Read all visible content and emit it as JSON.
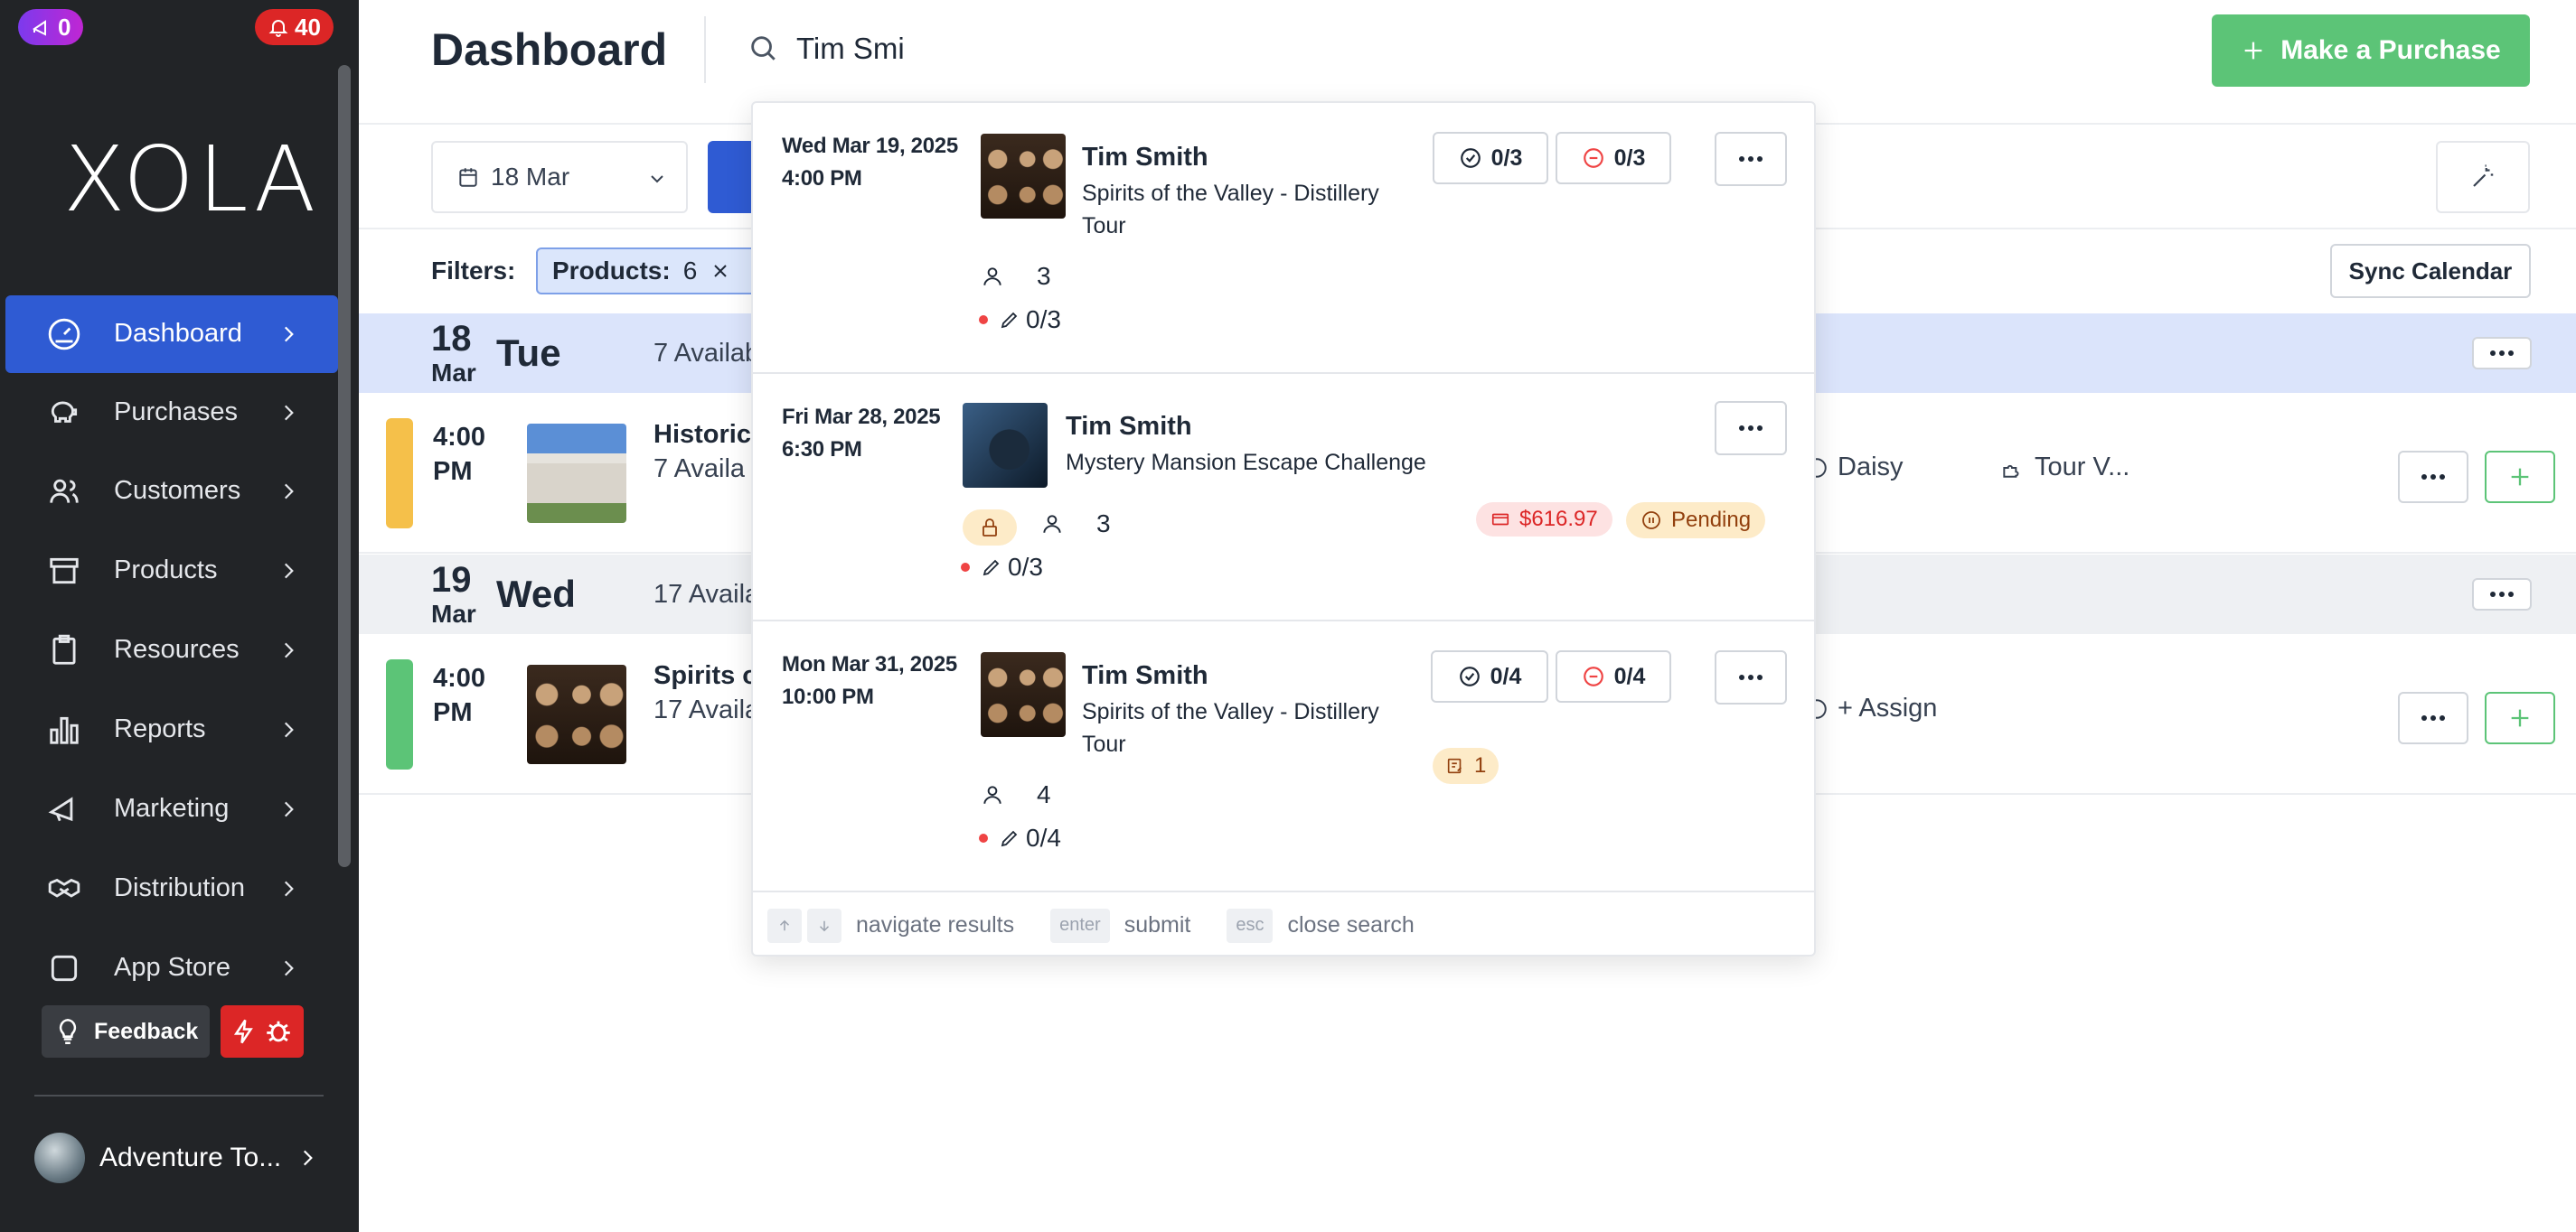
{
  "sidebar": {
    "badge_left": "0",
    "badge_right": "40",
    "logo": "XOLA",
    "items": [
      {
        "label": "Dashboard",
        "active": true
      },
      {
        "label": "Purchases"
      },
      {
        "label": "Customers"
      },
      {
        "label": "Products"
      },
      {
        "label": "Resources"
      },
      {
        "label": "Reports"
      },
      {
        "label": "Marketing"
      },
      {
        "label": "Distribution"
      },
      {
        "label": "App Store"
      }
    ],
    "feedback_label": "Feedback",
    "account_name": "Adventure To..."
  },
  "header": {
    "title": "Dashboard",
    "search_value": "Tim Smi",
    "purchase_label": "Make a Purchase"
  },
  "toolbar": {
    "date_value": "18 Mar",
    "filters_label": "Filters:",
    "filter_chip_label": "Products:",
    "filter_chip_count": "6",
    "sync_label": "Sync Calendar"
  },
  "days": [
    {
      "num": "18",
      "mon": "Mar",
      "name": "Tue",
      "avail": "7 Availab"
    },
    {
      "num": "19",
      "mon": "Mar",
      "name": "Wed",
      "avail": "17 Availa"
    }
  ],
  "slots": [
    {
      "time": "4:00",
      "ampm": "PM",
      "title": "Historic",
      "avail": "7 Availa",
      "guide": "Daisy",
      "vehicle": "Tour V...",
      "color": "#f5c04a"
    },
    {
      "time": "4:00",
      "ampm": "PM",
      "title": "Spirits o",
      "avail": "17 Availa",
      "guide": "+ Assign",
      "color": "#5cc477"
    }
  ],
  "search_results": [
    {
      "date": "Wed Mar 19, 2025",
      "time": "4:00 PM",
      "name": "Tim Smith",
      "product_line1": "Spirits of the Valley - Distillery",
      "product_line2": "Tour",
      "checked_in": "0/3",
      "no_show": "0/3",
      "guests": "3",
      "waivers": "0/3"
    },
    {
      "date": "Fri Mar 28, 2025",
      "time": "6:30 PM",
      "name": "Tim Smith",
      "product_line1": "Mystery Mansion Escape Challenge",
      "guests": "3",
      "waivers": "0/3",
      "amount": "$616.97",
      "status": "Pending"
    },
    {
      "date": "Mon Mar 31, 2025",
      "time": "10:00 PM",
      "name": "Tim Smith",
      "product_line1": "Spirits of the Valley - Distillery",
      "product_line2": "Tour",
      "checked_in": "0/4",
      "no_show": "0/4",
      "notes": "1",
      "guests": "4",
      "waivers": "0/4"
    }
  ],
  "footer": {
    "kbd_enter": "enter",
    "kbd_esc": "esc",
    "navigate": "navigate results",
    "submit": "submit",
    "close": "close search"
  },
  "colors": {
    "sidebar_bg": "#222427",
    "accent_blue": "#2f5bd3",
    "accent_green": "#5cc477",
    "danger": "#dc2626"
  }
}
